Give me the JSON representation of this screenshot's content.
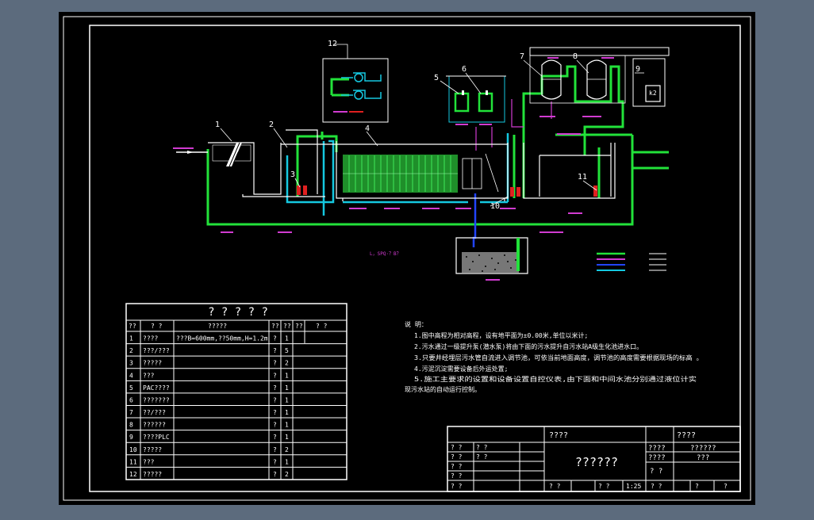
{
  "colors": {
    "background": "#5c6b7d",
    "sheet": "#000000",
    "line": "#ffffff",
    "green": "#22e23a",
    "cyan": "#15c8e0",
    "blue": "#2244ff",
    "magenta": "#d13bd1",
    "red": "#e02020",
    "media": "#1f8f2a"
  },
  "callouts": [
    "1",
    "2",
    "3",
    "4",
    "5",
    "6",
    "7",
    "8",
    "9",
    "10",
    "11",
    "12"
  ],
  "drawing": {
    "annotation_text": "L，SPQ·？B？",
    "box9_label": "k2"
  },
  "parts_table": {
    "title": "? ? ? ? ?",
    "headers": [
      "??",
      "? ?",
      "?????",
      "??",
      "??",
      "??",
      "? ?"
    ],
    "rows": [
      {
        "no": "1",
        "name": "????",
        "spec": "???B=600mm,??50mm,H=1.2m",
        "unit": "?",
        "qty": "1"
      },
      {
        "no": "2",
        "name": "???/???",
        "spec": "",
        "unit": "?",
        "qty": "5"
      },
      {
        "no": "3",
        "name": "?????",
        "spec": "",
        "unit": "?",
        "qty": "2"
      },
      {
        "no": "4",
        "name": "???",
        "spec": "",
        "unit": "?",
        "qty": "1"
      },
      {
        "no": "5",
        "name": "PAC????",
        "spec": "",
        "unit": "?",
        "qty": "1"
      },
      {
        "no": "6",
        "name": "???????",
        "spec": "",
        "unit": "?",
        "qty": "1"
      },
      {
        "no": "7",
        "name": "??/???",
        "spec": "",
        "unit": "?",
        "qty": "1"
      },
      {
        "no": "8",
        "name": "??????",
        "spec": "",
        "unit": "?",
        "qty": "1"
      },
      {
        "no": "9",
        "name": "????PLC",
        "spec": "",
        "unit": "?",
        "qty": "1"
      },
      {
        "no": "10",
        "name": "?????",
        "spec": "",
        "unit": "?",
        "qty": "2"
      },
      {
        "no": "11",
        "name": "???",
        "spec": "",
        "unit": "?",
        "qty": "1"
      },
      {
        "no": "12",
        "name": "?????",
        "spec": "",
        "unit": "?",
        "qty": "2"
      }
    ]
  },
  "notes": {
    "heading": "说 明：",
    "lines": [
      "1.图中高程为相对高程，设有地平面为±0.00米,单位以米计;",
      "2.污水通过一级提升泵(潜水泵)将由下面的污水提升自污水站A级生化池进水口。",
      "3.只要井经埋层污水管自流进入调节池，可依当前地面高度，调节池的高度需要根据现场的标高 。",
      "4.污泥沉淀需要设备后外运处置;",
      "5.施工主要求的设置和设备设置自控仪表,由下面和中间水池分别通过液位计实",
      "现污水站的自动运行控制。"
    ]
  },
  "title_block": {
    "top_a": "????",
    "top_b": "????",
    "center_title": "??????",
    "right_a": "????",
    "right_b": "??????",
    "right_c": "????",
    "right_d": "???",
    "right_e": "? ?",
    "left_cells": [
      "? ?",
      "? ?",
      "? ?",
      "? ?",
      "? ?",
      "? ?",
      "? ?"
    ],
    "bottom_cells": [
      "? ?",
      "? ?",
      "1:25",
      "? ?",
      "?",
      "?"
    ]
  }
}
